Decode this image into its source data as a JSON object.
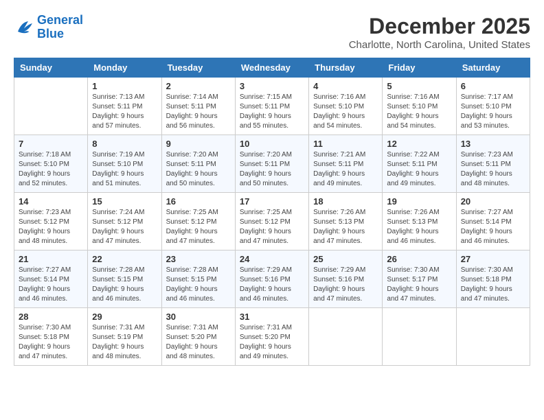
{
  "logo": {
    "line1": "General",
    "line2": "Blue"
  },
  "title": "December 2025",
  "subtitle": "Charlotte, North Carolina, United States",
  "headers": [
    "Sunday",
    "Monday",
    "Tuesday",
    "Wednesday",
    "Thursday",
    "Friday",
    "Saturday"
  ],
  "weeks": [
    [
      {
        "day": "",
        "info": ""
      },
      {
        "day": "1",
        "info": "Sunrise: 7:13 AM\nSunset: 5:11 PM\nDaylight: 9 hours\nand 57 minutes."
      },
      {
        "day": "2",
        "info": "Sunrise: 7:14 AM\nSunset: 5:11 PM\nDaylight: 9 hours\nand 56 minutes."
      },
      {
        "day": "3",
        "info": "Sunrise: 7:15 AM\nSunset: 5:11 PM\nDaylight: 9 hours\nand 55 minutes."
      },
      {
        "day": "4",
        "info": "Sunrise: 7:16 AM\nSunset: 5:10 PM\nDaylight: 9 hours\nand 54 minutes."
      },
      {
        "day": "5",
        "info": "Sunrise: 7:16 AM\nSunset: 5:10 PM\nDaylight: 9 hours\nand 54 minutes."
      },
      {
        "day": "6",
        "info": "Sunrise: 7:17 AM\nSunset: 5:10 PM\nDaylight: 9 hours\nand 53 minutes."
      }
    ],
    [
      {
        "day": "7",
        "info": "Sunrise: 7:18 AM\nSunset: 5:10 PM\nDaylight: 9 hours\nand 52 minutes."
      },
      {
        "day": "8",
        "info": "Sunrise: 7:19 AM\nSunset: 5:10 PM\nDaylight: 9 hours\nand 51 minutes."
      },
      {
        "day": "9",
        "info": "Sunrise: 7:20 AM\nSunset: 5:11 PM\nDaylight: 9 hours\nand 50 minutes."
      },
      {
        "day": "10",
        "info": "Sunrise: 7:20 AM\nSunset: 5:11 PM\nDaylight: 9 hours\nand 50 minutes."
      },
      {
        "day": "11",
        "info": "Sunrise: 7:21 AM\nSunset: 5:11 PM\nDaylight: 9 hours\nand 49 minutes."
      },
      {
        "day": "12",
        "info": "Sunrise: 7:22 AM\nSunset: 5:11 PM\nDaylight: 9 hours\nand 49 minutes."
      },
      {
        "day": "13",
        "info": "Sunrise: 7:23 AM\nSunset: 5:11 PM\nDaylight: 9 hours\nand 48 minutes."
      }
    ],
    [
      {
        "day": "14",
        "info": "Sunrise: 7:23 AM\nSunset: 5:12 PM\nDaylight: 9 hours\nand 48 minutes."
      },
      {
        "day": "15",
        "info": "Sunrise: 7:24 AM\nSunset: 5:12 PM\nDaylight: 9 hours\nand 47 minutes."
      },
      {
        "day": "16",
        "info": "Sunrise: 7:25 AM\nSunset: 5:12 PM\nDaylight: 9 hours\nand 47 minutes."
      },
      {
        "day": "17",
        "info": "Sunrise: 7:25 AM\nSunset: 5:12 PM\nDaylight: 9 hours\nand 47 minutes."
      },
      {
        "day": "18",
        "info": "Sunrise: 7:26 AM\nSunset: 5:13 PM\nDaylight: 9 hours\nand 47 minutes."
      },
      {
        "day": "19",
        "info": "Sunrise: 7:26 AM\nSunset: 5:13 PM\nDaylight: 9 hours\nand 46 minutes."
      },
      {
        "day": "20",
        "info": "Sunrise: 7:27 AM\nSunset: 5:14 PM\nDaylight: 9 hours\nand 46 minutes."
      }
    ],
    [
      {
        "day": "21",
        "info": "Sunrise: 7:27 AM\nSunset: 5:14 PM\nDaylight: 9 hours\nand 46 minutes."
      },
      {
        "day": "22",
        "info": "Sunrise: 7:28 AM\nSunset: 5:15 PM\nDaylight: 9 hours\nand 46 minutes."
      },
      {
        "day": "23",
        "info": "Sunrise: 7:28 AM\nSunset: 5:15 PM\nDaylight: 9 hours\nand 46 minutes."
      },
      {
        "day": "24",
        "info": "Sunrise: 7:29 AM\nSunset: 5:16 PM\nDaylight: 9 hours\nand 46 minutes."
      },
      {
        "day": "25",
        "info": "Sunrise: 7:29 AM\nSunset: 5:16 PM\nDaylight: 9 hours\nand 47 minutes."
      },
      {
        "day": "26",
        "info": "Sunrise: 7:30 AM\nSunset: 5:17 PM\nDaylight: 9 hours\nand 47 minutes."
      },
      {
        "day": "27",
        "info": "Sunrise: 7:30 AM\nSunset: 5:18 PM\nDaylight: 9 hours\nand 47 minutes."
      }
    ],
    [
      {
        "day": "28",
        "info": "Sunrise: 7:30 AM\nSunset: 5:18 PM\nDaylight: 9 hours\nand 47 minutes."
      },
      {
        "day": "29",
        "info": "Sunrise: 7:31 AM\nSunset: 5:19 PM\nDaylight: 9 hours\nand 48 minutes."
      },
      {
        "day": "30",
        "info": "Sunrise: 7:31 AM\nSunset: 5:20 PM\nDaylight: 9 hours\nand 48 minutes."
      },
      {
        "day": "31",
        "info": "Sunrise: 7:31 AM\nSunset: 5:20 PM\nDaylight: 9 hours\nand 49 minutes."
      },
      {
        "day": "",
        "info": ""
      },
      {
        "day": "",
        "info": ""
      },
      {
        "day": "",
        "info": ""
      }
    ]
  ]
}
